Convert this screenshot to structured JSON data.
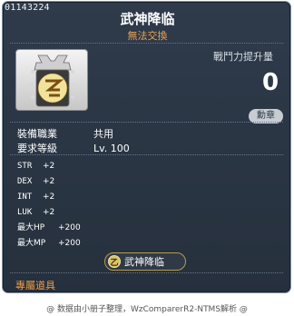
{
  "item": {
    "id": "01143224",
    "name": "武神降临",
    "trade_note": "無法交換",
    "icon": "wu-shen-medal-icon",
    "icon_colors": {
      "frame": "#d7d7d7",
      "gem": "#d1a64a",
      "panel": "#2b2b2b"
    }
  },
  "power": {
    "label": "戰鬥力提升量",
    "value": "0"
  },
  "chapter_button": {
    "label": "勳章"
  },
  "requirements": [
    {
      "label": "裝備職業",
      "value": "共用"
    },
    {
      "label": "要求等級",
      "value": "Lv. 100"
    }
  ],
  "stats": [
    {
      "name": "STR",
      "value": "+2"
    },
    {
      "name": "DEX",
      "value": "+2"
    },
    {
      "name": "INT",
      "value": "+2"
    },
    {
      "name": "LUK",
      "value": "+2"
    },
    {
      "name": "最大HP",
      "value": "+200"
    },
    {
      "name": "最大MP",
      "value": "+200"
    }
  ],
  "set_effect": {
    "label": "武神降临",
    "emblem": "乙"
  },
  "exclusive_label": "專屬道具",
  "credit": "@ 数据由小册子整理，WzComparerR2-NTMS解析 @",
  "colors": {
    "background": "#2b3644",
    "accent_orange": "#e7a34f",
    "text": "#ffffff"
  }
}
